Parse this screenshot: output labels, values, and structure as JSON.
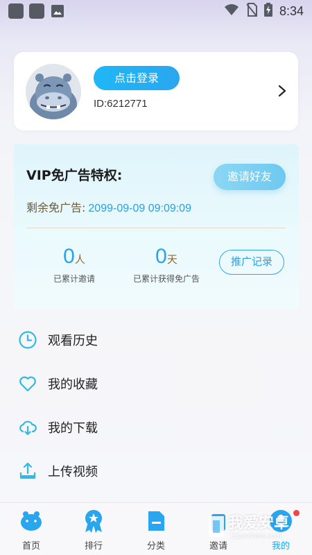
{
  "status_bar": {
    "time": "8:34"
  },
  "profile": {
    "login_label": "点击登录",
    "user_id": "ID:6212771"
  },
  "vip": {
    "title": "VIP免广告特权:",
    "invite_label": "邀请好友",
    "remaining_label": "剩余免广告:",
    "remaining_value": "2099-09-09 09:09:09",
    "invited_count": "0",
    "invited_unit": "人",
    "invited_caption": "已累计邀请",
    "days_count": "0",
    "days_unit": "天",
    "days_caption": "已累计获得免广告",
    "promo_record_label": "推广记录"
  },
  "menu": [
    {
      "label": "观看历史",
      "icon": "clock-icon"
    },
    {
      "label": "我的收藏",
      "icon": "heart-icon"
    },
    {
      "label": "我的下载",
      "icon": "cloud-download-icon"
    },
    {
      "label": "上传视频",
      "icon": "upload-icon"
    }
  ],
  "nav": [
    {
      "label": "首页",
      "icon": "hippo-home-icon"
    },
    {
      "label": "排行",
      "icon": "ranking-badge-icon"
    },
    {
      "label": "分类",
      "icon": "category-icon"
    },
    {
      "label": "邀请",
      "icon": "invite-icon"
    },
    {
      "label": "我的",
      "icon": "profile-icon",
      "active": true
    }
  ],
  "watermark": {
    "main": "我爱安卓",
    "sub": "52android.com"
  },
  "colors": {
    "accent": "#27a3ea",
    "gold_text": "#6b5a3a",
    "badge_red": "#f24545"
  }
}
